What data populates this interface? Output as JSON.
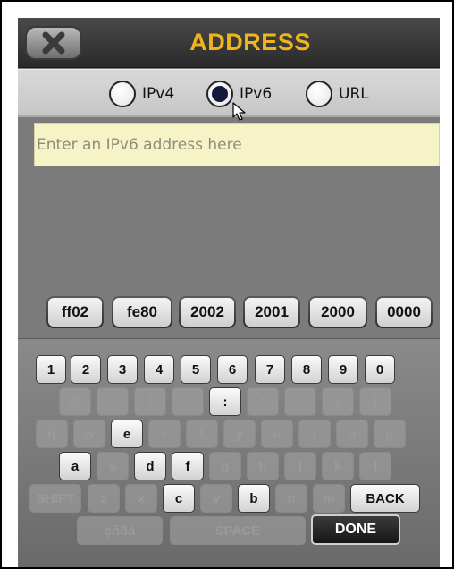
{
  "header": {
    "title": "ADDRESS",
    "close_icon": "close-x-icon"
  },
  "address_type": {
    "options": [
      {
        "label": "IPv4",
        "checked": false
      },
      {
        "label": "IPv6",
        "checked": true
      },
      {
        "label": "URL",
        "checked": false
      }
    ]
  },
  "address_input": {
    "value": "",
    "placeholder": "Enter an IPv6 address here"
  },
  "prefixes": [
    "ff02",
    "fe80",
    "2002",
    "2001",
    "2000",
    "0000"
  ],
  "keyboard": {
    "rows": [
      [
        {
          "label": "1",
          "enabled": true
        },
        {
          "label": "2",
          "enabled": true
        },
        {
          "label": "3",
          "enabled": true
        },
        {
          "label": "4",
          "enabled": true
        },
        {
          "label": "5",
          "enabled": true
        },
        {
          "label": "6",
          "enabled": true
        },
        {
          "label": "7",
          "enabled": true
        },
        {
          "label": "8",
          "enabled": true
        },
        {
          "label": "9",
          "enabled": true
        },
        {
          "label": "0",
          "enabled": true
        }
      ],
      [
        {
          "label": "@",
          "enabled": false
        },
        {
          "label": "-",
          "enabled": false
        },
        {
          "label": "/",
          "enabled": false
        },
        {
          "label": ".",
          "enabled": false
        },
        {
          "label": ":",
          "enabled": true
        },
        {
          "label": "*",
          "enabled": false
        },
        {
          "label": "_",
          "enabled": false
        },
        {
          "label": "(",
          "enabled": false
        },
        {
          "label": ")",
          "enabled": false
        }
      ],
      [
        {
          "label": "q",
          "enabled": false
        },
        {
          "label": "w",
          "enabled": false
        },
        {
          "label": "e",
          "enabled": true
        },
        {
          "label": "r",
          "enabled": false
        },
        {
          "label": "t",
          "enabled": false
        },
        {
          "label": "y",
          "enabled": false
        },
        {
          "label": "u",
          "enabled": false
        },
        {
          "label": "i",
          "enabled": false
        },
        {
          "label": "o",
          "enabled": false
        },
        {
          "label": "p",
          "enabled": false
        }
      ],
      [
        {
          "label": "a",
          "enabled": true
        },
        {
          "label": "s",
          "enabled": false
        },
        {
          "label": "d",
          "enabled": true
        },
        {
          "label": "f",
          "enabled": true
        },
        {
          "label": "g",
          "enabled": false
        },
        {
          "label": "h",
          "enabled": false
        },
        {
          "label": "j",
          "enabled": false
        },
        {
          "label": "k",
          "enabled": false
        },
        {
          "label": "l",
          "enabled": false
        }
      ],
      [
        {
          "label": "SHIFT",
          "enabled": false
        },
        {
          "label": "z",
          "enabled": false
        },
        {
          "label": "x",
          "enabled": false
        },
        {
          "label": "c",
          "enabled": true
        },
        {
          "label": "v",
          "enabled": false
        },
        {
          "label": "b",
          "enabled": true
        },
        {
          "label": "n",
          "enabled": false
        },
        {
          "label": "m",
          "enabled": false
        },
        {
          "label": "BACK",
          "enabled": true
        }
      ],
      [
        {
          "label": "çñßà",
          "enabled": false
        },
        {
          "label": "SPACE",
          "enabled": false
        },
        {
          "label": "DONE",
          "enabled": true
        }
      ]
    ]
  },
  "colors": {
    "title": "#f0b51c",
    "input_background": "#f6f3c7",
    "radio_checked_fill": "#14193c"
  }
}
